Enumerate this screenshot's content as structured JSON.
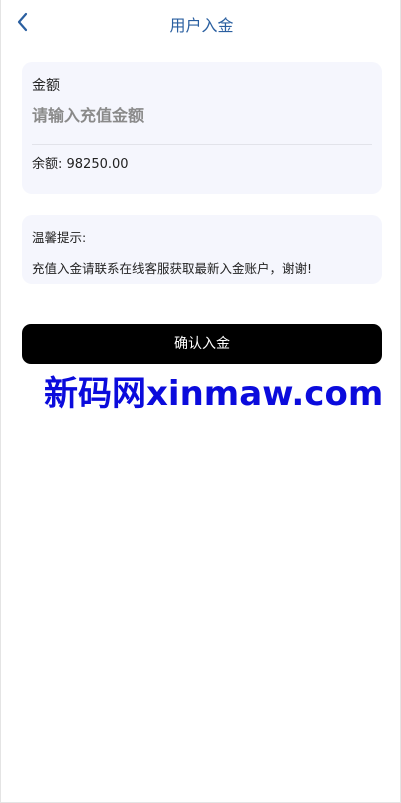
{
  "header": {
    "title": "用户入金",
    "back_icon": "chevron-left-icon",
    "accent_color": "#2a5fa0"
  },
  "amount_card": {
    "label": "金额",
    "input_placeholder": "请输入充值金额",
    "input_value": "",
    "balance_label": "余额: 98250.00"
  },
  "tip_card": {
    "title": "温馨提示:",
    "text": "充值入金请联系在线客服获取最新入金账户，谢谢!"
  },
  "confirm_button": {
    "label": "确认入金",
    "color": "#000000"
  },
  "watermark": {
    "text": "新码网xinmaw.com",
    "color": "#0b0bdc"
  }
}
